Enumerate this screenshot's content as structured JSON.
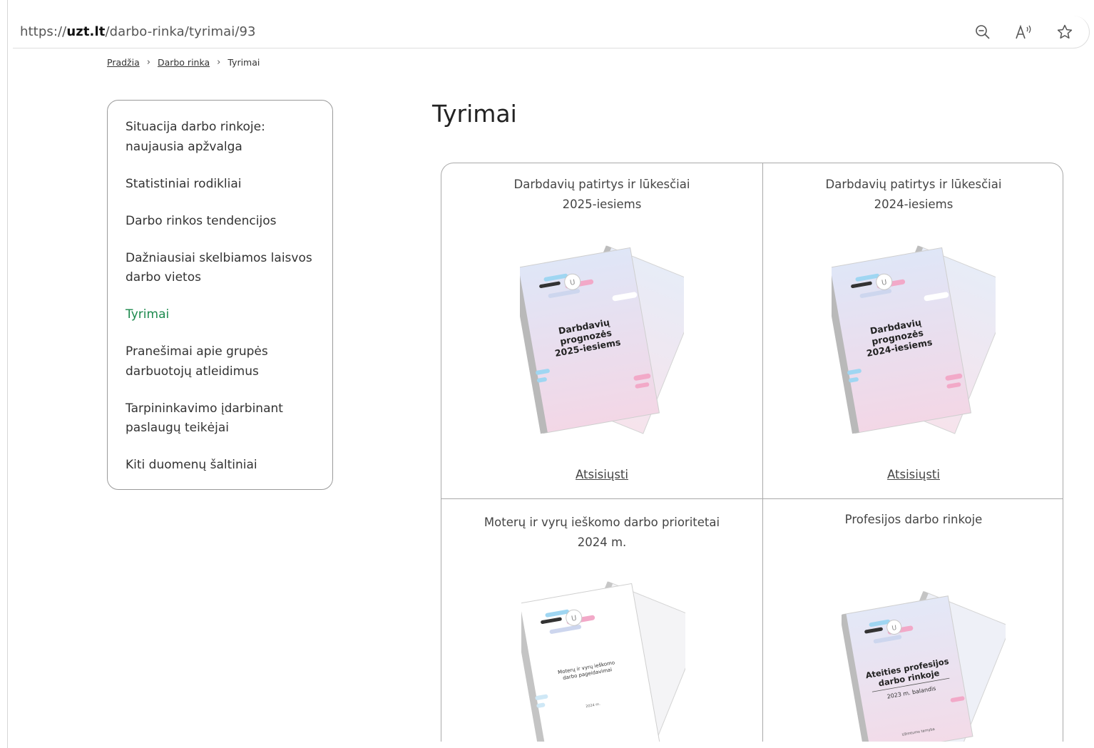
{
  "browser": {
    "url_prefix": "https://",
    "url_domain": "uzt.lt",
    "url_path": "/darbo-rinka/tyrimai/93"
  },
  "breadcrumb": [
    {
      "label": "Pradžia"
    },
    {
      "label": "Darbo rinka"
    },
    {
      "label": "Tyrimai"
    }
  ],
  "sidebar": {
    "items": [
      {
        "label": "Situacija darbo rinkoje: naujausia apžvalga"
      },
      {
        "label": "Statistiniai rodikliai"
      },
      {
        "label": "Darbo rinkos tendencijos"
      },
      {
        "label": "Dažniausiai skelbiamos laisvos darbo vietos"
      },
      {
        "label": "Tyrimai"
      },
      {
        "label": "Pranešimai apie grupės darbuotojų atleidimus"
      },
      {
        "label": "Tarpininkavimo įdarbinant paslaugų teikėjai"
      },
      {
        "label": "Kiti duomenų šaltiniai"
      }
    ]
  },
  "main": {
    "title": "Tyrimai",
    "cards": [
      {
        "title_l1": "Darbdavių patirtys ir lūkesčiai",
        "title_l2": "2025-iesiems",
        "cover_l1": "Darbdavių",
        "cover_l2": "prognozės",
        "cover_l3": "2025-iesiems",
        "download": "Atsisiųsti"
      },
      {
        "title_l1": "Darbdavių patirtys ir lūkesčiai",
        "title_l2": "2024-iesiems",
        "cover_l1": "Darbdavių",
        "cover_l2": "prognozės",
        "cover_l3": "2024-iesiems",
        "download": "Atsisiųsti"
      },
      {
        "title_l1": "Moterų ir vyrų ieškomo darbo prioritetai",
        "title_l2": "2024 m.",
        "cover_l1": "Moterų ir vyrų ieškomo",
        "cover_l2": "darbo pageidavimai",
        "cover_l3": "2024 m."
      },
      {
        "title_l1": "Profesijos darbo rinkoje",
        "cover_l1": "Ateities profesijos",
        "cover_l2": "darbo rinkoje",
        "cover_l3": "2023 m. balandis",
        "cover_brand": "Užimtumo tarnyba"
      }
    ]
  },
  "colors": {
    "active_link": "#1d8a4e",
    "border": "#a9a9a9",
    "accent_pink": "#f2a9c8",
    "accent_blue": "#9fd6f2"
  }
}
